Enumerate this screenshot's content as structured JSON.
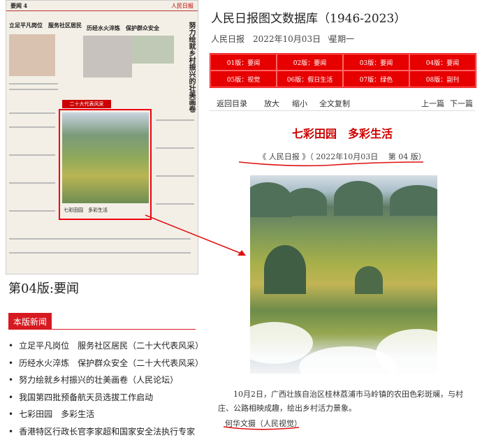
{
  "thumbnail": {
    "section": "要闻",
    "page_no": "4",
    "masthead": "人民日报",
    "headlines": [
      "立足平凡岗位　服务社区居民",
      "历经水火淬炼　保护群众安全",
      "努力绘就乡村振兴的壮美画卷"
    ],
    "tag": "二十大代表风采",
    "caption": "七彩田园　多彩生活"
  },
  "page_label": "第04版:要闻",
  "news_button": "本版新闻",
  "news_list": [
    "立足平凡岗位　服务社区居民（二十大代表风采）",
    "历经水火淬炼　保护群众安全（二十大代表风采）",
    "努力绘就乡村振兴的壮美画卷（人民论坛）",
    "我国第四批预备航天员选拔工作启动",
    "七彩田园　多彩生活",
    "香港特区行政长官李家超和国家安全法执行专家"
  ],
  "db_title": "人民日报图文数据库（1946-2023）",
  "date_line": "人民日报　2022年10月03日　星期一",
  "editions": [
    "01版：要闻",
    "02版：要闻",
    "03版：要闻",
    "04版：要闻",
    "05版：视觉",
    "06版：假日生活",
    "07版：绿色",
    "08版：副刊"
  ],
  "toolbar": {
    "back": "返回目录",
    "zoom_in": "放大",
    "zoom_out": "缩小",
    "copy": "全文复制",
    "prev": "上一篇",
    "next": "下一篇"
  },
  "article": {
    "title": "七彩田园　多彩生活",
    "source": "《 人民日报 》（ 2022年10月03日　 第 04 版）",
    "body": "10月2日，广西壮族自治区桂林荔浦市马岭镇的农田色彩斑斓，与村庄、公路相映成趣，绘出乡村活力景象。",
    "byline": "何华文摄（人民视觉）"
  },
  "colors": {
    "accent": "#d71920",
    "title_red": "#c00000"
  }
}
